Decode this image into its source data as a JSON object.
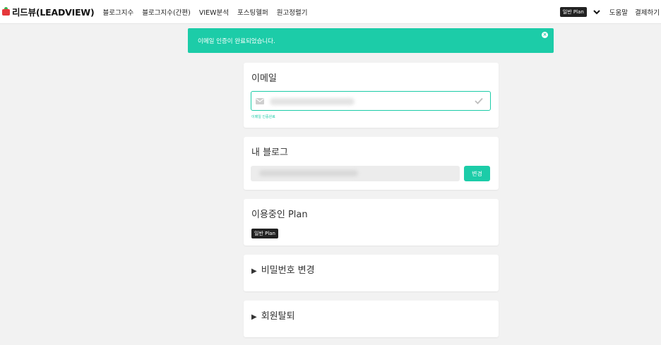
{
  "nav": {
    "brand": "리드뷰(LEADVIEW)",
    "links": [
      "블로그지수",
      "블로그지수(간편)",
      "VIEW분석",
      "포스팅헬퍼",
      "원고정렬기"
    ],
    "plan_badge": "일반 Plan",
    "help": "도움말",
    "payment": "결제하기"
  },
  "alert": {
    "message": "이메일 인증이 완료되었습니다.",
    "color": "#1ccca8"
  },
  "email_card": {
    "title": "이메일",
    "status": "이메일 인증완료"
  },
  "blog_card": {
    "title": "내 블로그",
    "change_label": "변경"
  },
  "plan_card": {
    "title": "이용중인 Plan",
    "plan_badge": "일반 Plan"
  },
  "password_card": {
    "title": "비밀번호 변경"
  },
  "withdraw_card": {
    "title": "회원탈퇴"
  },
  "icons": [
    "brand-tomato-icon",
    "chevron-down-icon",
    "close-icon",
    "mail-icon",
    "check-icon",
    "triangle-right-icon"
  ],
  "colors": {
    "accent": "#1ccca8",
    "dark_badge": "#222222"
  }
}
